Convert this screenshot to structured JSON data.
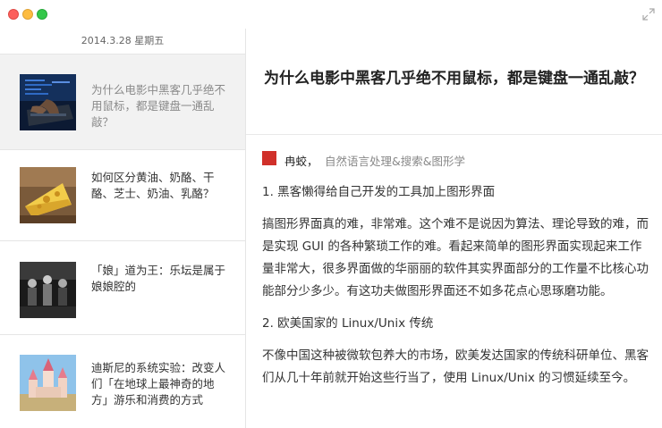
{
  "sidebar": {
    "date_header": "2014.3.28 星期五",
    "items": [
      {
        "title": "为什么电影中黑客几乎绝不用鼠标，都是键盘一通乱敲？"
      },
      {
        "title": "如何区分黄油、奶酪、干酪、芝士、奶油、乳酪？"
      },
      {
        "title": "「娘」道为王：乐坛是属于娘娘腔的"
      },
      {
        "title": "迪斯尼的系统实验：改变人们「在地球上最神奇的地方」游乐和消费的方式"
      }
    ]
  },
  "article": {
    "title": "为什么电影中黑客几乎绝不用鼠标，都是键盘一通乱敲？",
    "author_name": "冉蛟，",
    "author_bio": "自然语言处理&搜索&图形学",
    "paragraphs": [
      "1. 黑客懒得给自己开发的工具加上图形界面",
      "搞图形界面真的难，非常难。这个难不是说因为算法、理论导致的难，而是实现 GUI 的各种繁琐工作的难。看起来简单的图形界面实现起来工作量非常大，很多界面做的华丽丽的软件其实界面部分的工作量不比核心功能部分少多少。有这功夫做图形界面还不如多花点心思琢磨功能。",
      "2. 欧美国家的 Linux/Unix 传统",
      "不像中国这种被微软包养大的市场，欧美发达国家的传统科研单位、黑客们从几十年前就开始这些行当了，使用 Linux/Unix 的习惯延续至今。"
    ]
  }
}
